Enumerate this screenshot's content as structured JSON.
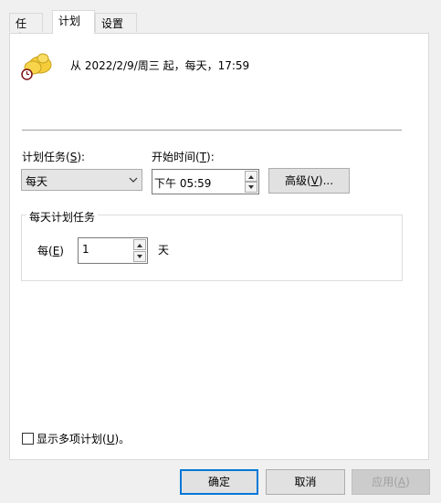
{
  "tabs": [
    {
      "label": "任务"
    },
    {
      "label": "计划"
    },
    {
      "label": "设置"
    }
  ],
  "summary": "从 2022/2/9/周三 起，每天，17:59",
  "schedule_task": {
    "label_pre": "计划任务(",
    "mnemonic": "S",
    "label_post": "):",
    "value": "每天"
  },
  "start_time": {
    "label_pre": "开始时间(",
    "mnemonic": "T",
    "label_post": "):",
    "value": "下午 05:59"
  },
  "advanced_button": {
    "pre": "高级(",
    "mnemonic": "V",
    "post": ")..."
  },
  "daily_group": {
    "title": "每天计划任务",
    "every_pre": "每(",
    "every_mnemonic": "E",
    "every_post": ")",
    "value": "1",
    "unit": "天"
  },
  "show_multiple": {
    "pre": "显示多项计划(",
    "mnemonic": "U",
    "post": ")。",
    "checked": false
  },
  "buttons": {
    "ok": "确定",
    "cancel": "取消",
    "apply_pre": "应用(",
    "apply_mnemonic": "A",
    "apply_post": ")"
  },
  "colors": {
    "accent": "#0078d7",
    "disabled_text": "#a0a0a0",
    "icon_yellow": "#f5cd3b"
  },
  "icons": {
    "schedule": "scheduled-task-icon",
    "clock": "clock-overlay-icon",
    "dropdown": "chevron-down-icon",
    "spin_up": "spin-up-icon",
    "spin_down": "spin-down-icon"
  }
}
